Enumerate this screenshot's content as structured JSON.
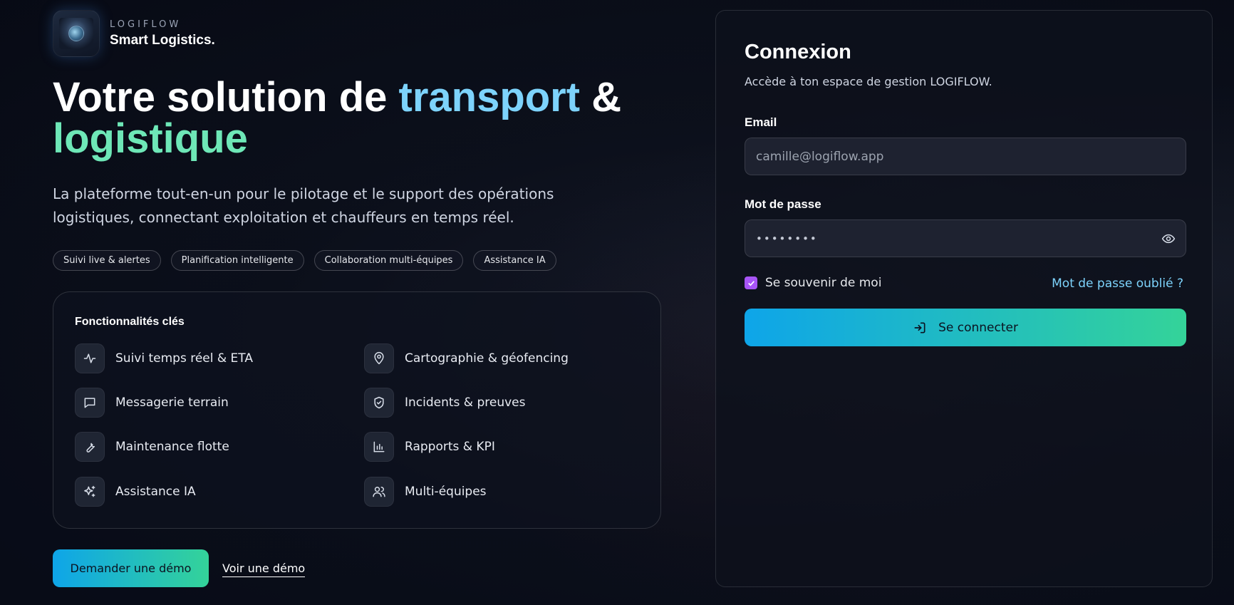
{
  "brand": {
    "name": "LOGIFLOW",
    "tagline": "Smart Logistics."
  },
  "hero": {
    "title_part1": "Votre solution de ",
    "title_highlight1": "transport",
    "title_part2": " & ",
    "title_highlight2": "logistique",
    "subtitle": "La plateforme tout-en-un pour le pilotage et le support des opérations logistiques, connectant exploitation et chauffeurs en temps réel."
  },
  "chips": [
    "Suivi live & alertes",
    "Planification intelligente",
    "Collaboration multi-équipes",
    "Assistance IA"
  ],
  "features": {
    "title": "Fonctionnalités clés",
    "items": [
      {
        "label": "Suivi temps réel & ETA",
        "icon": "activity-icon"
      },
      {
        "label": "Cartographie & géofencing",
        "icon": "map-pin-icon"
      },
      {
        "label": "Messagerie terrain",
        "icon": "message-icon"
      },
      {
        "label": "Incidents & preuves",
        "icon": "shield-check-icon"
      },
      {
        "label": "Maintenance flotte",
        "icon": "wrench-icon"
      },
      {
        "label": "Rapports & KPI",
        "icon": "bar-chart-icon"
      },
      {
        "label": "Assistance IA",
        "icon": "sparkles-icon"
      },
      {
        "label": "Multi-équipes",
        "icon": "users-icon"
      }
    ]
  },
  "actions": {
    "request_demo": "Demander une démo",
    "watch_demo": "Voir une démo"
  },
  "login": {
    "title": "Connexion",
    "subtitle": "Accède à ton espace de gestion LOGIFLOW.",
    "email_label": "Email",
    "email_placeholder": "camille@logiflow.app",
    "password_label": "Mot de passe",
    "password_mask": "••••••••",
    "remember_label": "Se souvenir de moi",
    "remember_checked": true,
    "forgot_label": "Mot de passe oublié ?",
    "submit_label": "Se connecter"
  },
  "colors": {
    "accent_blue": "#7dd3fc",
    "accent_green": "#6ee7b7",
    "gradient_start": "#0ea5e9",
    "gradient_end": "#34d399",
    "checkbox": "#a855f7"
  }
}
